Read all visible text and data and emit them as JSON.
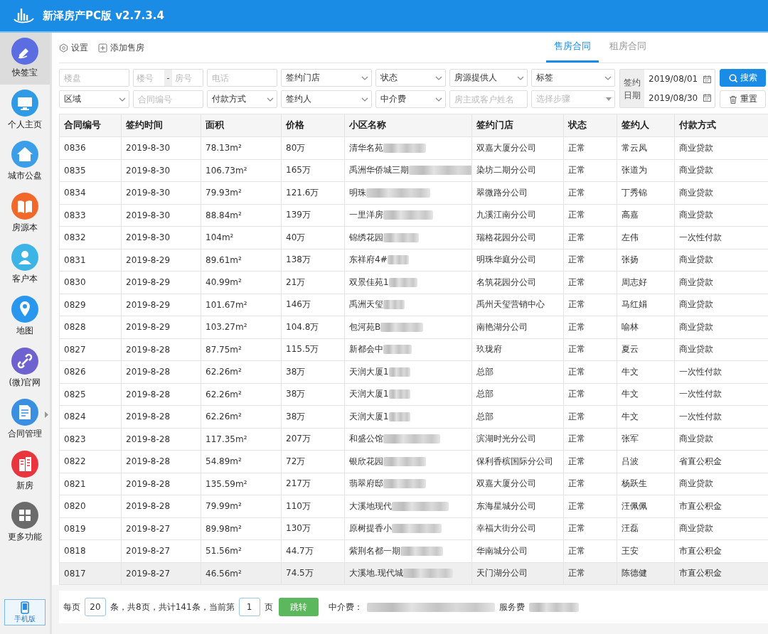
{
  "window": {
    "title": "新泽房产PC版 v2.7.3.4"
  },
  "sidebar": {
    "items": [
      {
        "label": "快签宝",
        "color": "#5b6de0",
        "selected": true,
        "has_submenu": false
      },
      {
        "label": "个人主页",
        "color": "#2f9be6",
        "selected": false,
        "has_submenu": false
      },
      {
        "label": "城市公盘",
        "color": "#3a9fe8",
        "selected": false,
        "has_submenu": false
      },
      {
        "label": "房源本",
        "color": "#f2672a",
        "selected": false,
        "has_submenu": false
      },
      {
        "label": "客户本",
        "color": "#3cb4e6",
        "selected": false,
        "has_submenu": false
      },
      {
        "label": "地图",
        "color": "#2a97ee",
        "selected": false,
        "has_submenu": false
      },
      {
        "label": "(微)官网",
        "color": "#6e62d0",
        "selected": false,
        "has_submenu": false
      },
      {
        "label": "合同管理",
        "color": "#3a8fe0",
        "selected": false,
        "has_submenu": true
      },
      {
        "label": "新房",
        "color": "#e8353e",
        "selected": false,
        "has_submenu": false
      },
      {
        "label": "更多功能",
        "color": "#6b6b6b",
        "selected": false,
        "has_submenu": false
      }
    ],
    "mobile": {
      "label": "手机版"
    }
  },
  "toolbar": [
    {
      "kind": "settings",
      "label": "设置"
    },
    {
      "kind": "add",
      "label": "添加售房"
    }
  ],
  "tabs": [
    {
      "label": "售房合同",
      "selected": true
    },
    {
      "label": "租房合同",
      "selected": false
    }
  ],
  "filters": [
    {
      "kind": "input",
      "placeholder": "楼盘"
    },
    {
      "kind": "range",
      "placeholder": "楼号",
      "separator": "-",
      "placeholder_2": "房号"
    },
    {
      "kind": "input",
      "placeholder": "电话"
    },
    {
      "kind": "select",
      "value": "签约门店"
    },
    {
      "kind": "select",
      "value": "状态"
    },
    {
      "kind": "select",
      "value": "房源提供人"
    },
    {
      "kind": "select",
      "value": "标签"
    },
    {
      "kind": "select",
      "value": "区域"
    },
    {
      "kind": "input",
      "placeholder": "合同编号"
    },
    {
      "kind": "select",
      "value": "付款方式"
    },
    {
      "kind": "select",
      "value": "签约人"
    },
    {
      "kind": "select",
      "value": "中介费"
    },
    {
      "kind": "input",
      "placeholder": "房主或客户姓名"
    },
    {
      "kind": "select",
      "placeholder": "选择步骤"
    }
  ],
  "date_range": {
    "label": "签约日期",
    "start": "2019/08/01",
    "end": "2019/08/30"
  },
  "buttons": [
    {
      "kind": "search",
      "label": "搜索"
    },
    {
      "kind": "reset",
      "label": "重置"
    }
  ],
  "table": {
    "columns": [
      "合同编号",
      "签约时间",
      "面积",
      "价格",
      "小区名称",
      "签约门店",
      "状态",
      "签约人",
      "付款方式"
    ],
    "rows": [
      {
        "selected": false,
        "redacted": true,
        "cells": [
          "0836",
          "2019-8-30",
          "78.13m²",
          "80万",
          "清华名苑",
          "双嘉大厦分公司",
          "正常",
          "常云凤",
          "商业贷款"
        ]
      },
      {
        "selected": false,
        "redacted": true,
        "cells": [
          "0835",
          "2019-8-30",
          "106.73m²",
          "165万",
          "禹洲华侨城三期",
          "染坊二期分公司",
          "正常",
          "张道为",
          "商业贷款"
        ]
      },
      {
        "selected": false,
        "redacted": true,
        "cells": [
          "0834",
          "2019-8-30",
          "79.93m²",
          "121.6万",
          "明珠",
          "翠微路分公司",
          "正常",
          "丁秀锦",
          "商业贷款"
        ]
      },
      {
        "selected": false,
        "redacted": true,
        "cells": [
          "0833",
          "2019-8-30",
          "88.84m²",
          "139万",
          "一里洋房",
          "九溪江南分公司",
          "正常",
          "高嘉",
          "商业贷款"
        ]
      },
      {
        "selected": false,
        "redacted": true,
        "cells": [
          "0832",
          "2019-8-30",
          "104m²",
          "40万",
          "锦绣花园",
          "瑞格花园分公司",
          "正常",
          "左伟",
          "一次性付款"
        ]
      },
      {
        "selected": false,
        "redacted": true,
        "cells": [
          "0831",
          "2019-8-29",
          "89.61m²",
          "138万",
          "东祥府4#",
          "明珠华庭分公司",
          "正常",
          "张扬",
          "商业贷款"
        ]
      },
      {
        "selected": false,
        "redacted": true,
        "cells": [
          "0830",
          "2019-8-29",
          "40.99m²",
          "21万",
          "双景佳苑1",
          "名筑花园分公司",
          "正常",
          "周志好",
          "商业贷款"
        ]
      },
      {
        "selected": false,
        "redacted": true,
        "cells": [
          "0829",
          "2019-8-29",
          "101.67m²",
          "146万",
          "禹洲天玺",
          "禹州天玺营销中心",
          "正常",
          "马红娟",
          "商业贷款"
        ]
      },
      {
        "selected": false,
        "redacted": true,
        "cells": [
          "0828",
          "2019-8-29",
          "103.27m²",
          "104.8万",
          "包河苑B",
          "南艳湖分公司",
          "正常",
          "喻林",
          "商业贷款"
        ]
      },
      {
        "selected": false,
        "redacted": true,
        "cells": [
          "0827",
          "2019-8-28",
          "87.75m²",
          "115.5万",
          "新都会中",
          "玖珑府",
          "正常",
          "夏云",
          "商业贷款"
        ]
      },
      {
        "selected": false,
        "redacted": true,
        "cells": [
          "0826",
          "2019-8-28",
          "62.26m²",
          "38万",
          "天润大厦1",
          "总部",
          "正常",
          "牛文",
          "一次性付款"
        ]
      },
      {
        "selected": false,
        "redacted": true,
        "cells": [
          "0825",
          "2019-8-28",
          "62.26m²",
          "38万",
          "天润大厦1",
          "总部",
          "正常",
          "牛文",
          "一次性付款"
        ]
      },
      {
        "selected": false,
        "redacted": true,
        "cells": [
          "0824",
          "2019-8-28",
          "62.26m²",
          "38万",
          "天润大厦1",
          "总部",
          "正常",
          "牛文",
          "一次性付款"
        ]
      },
      {
        "selected": false,
        "redacted": true,
        "cells": [
          "0823",
          "2019-8-28",
          "117.35m²",
          "207万",
          "和盛公馆",
          "滨湖时光分公司",
          "正常",
          "张军",
          "商业贷款"
        ]
      },
      {
        "selected": false,
        "redacted": true,
        "cells": [
          "0822",
          "2019-8-28",
          "54.89m²",
          "72万",
          "银欣花园",
          "保利香槟国际分公司",
          "正常",
          "吕波",
          "省直公积金"
        ]
      },
      {
        "selected": false,
        "redacted": true,
        "cells": [
          "0821",
          "2019-8-28",
          "135.59m²",
          "217万",
          "翡翠府邸",
          "双嘉大厦分公司",
          "正常",
          "杨跃生",
          "商业贷款"
        ]
      },
      {
        "selected": false,
        "redacted": true,
        "cells": [
          "0820",
          "2019-8-28",
          "79.99m²",
          "110万",
          "大溪地现代",
          "东海星城分公司",
          "正常",
          "汪佩佩",
          "市直公积金"
        ]
      },
      {
        "selected": false,
        "redacted": true,
        "cells": [
          "0819",
          "2019-8-27",
          "89.98m²",
          "130万",
          "原树提香小",
          "幸福大街分公司",
          "正常",
          "汪磊",
          "商业贷款"
        ]
      },
      {
        "selected": false,
        "redacted": true,
        "cells": [
          "0818",
          "2019-8-27",
          "51.56m²",
          "44.7万",
          "紫荆名都一期",
          "华南城分公司",
          "正常",
          "王安",
          "市直公积金"
        ]
      },
      {
        "selected": true,
        "redacted": true,
        "cells": [
          "0817",
          "2019-8-27",
          "46.56m²",
          "74.5万",
          "大溪地.现代城",
          "天门湖分公司",
          "正常",
          "陈德健",
          "市直公积金"
        ]
      }
    ]
  },
  "pagination": {
    "per_page_label": "每页",
    "per_page": "20",
    "summary": "条，共8页，共计141条，当前第",
    "current_page": "1",
    "page_label": "页",
    "jump_button": "跳转",
    "fee_label": "中介费：",
    "service_fee_label": "服务费",
    "redacted": true
  }
}
